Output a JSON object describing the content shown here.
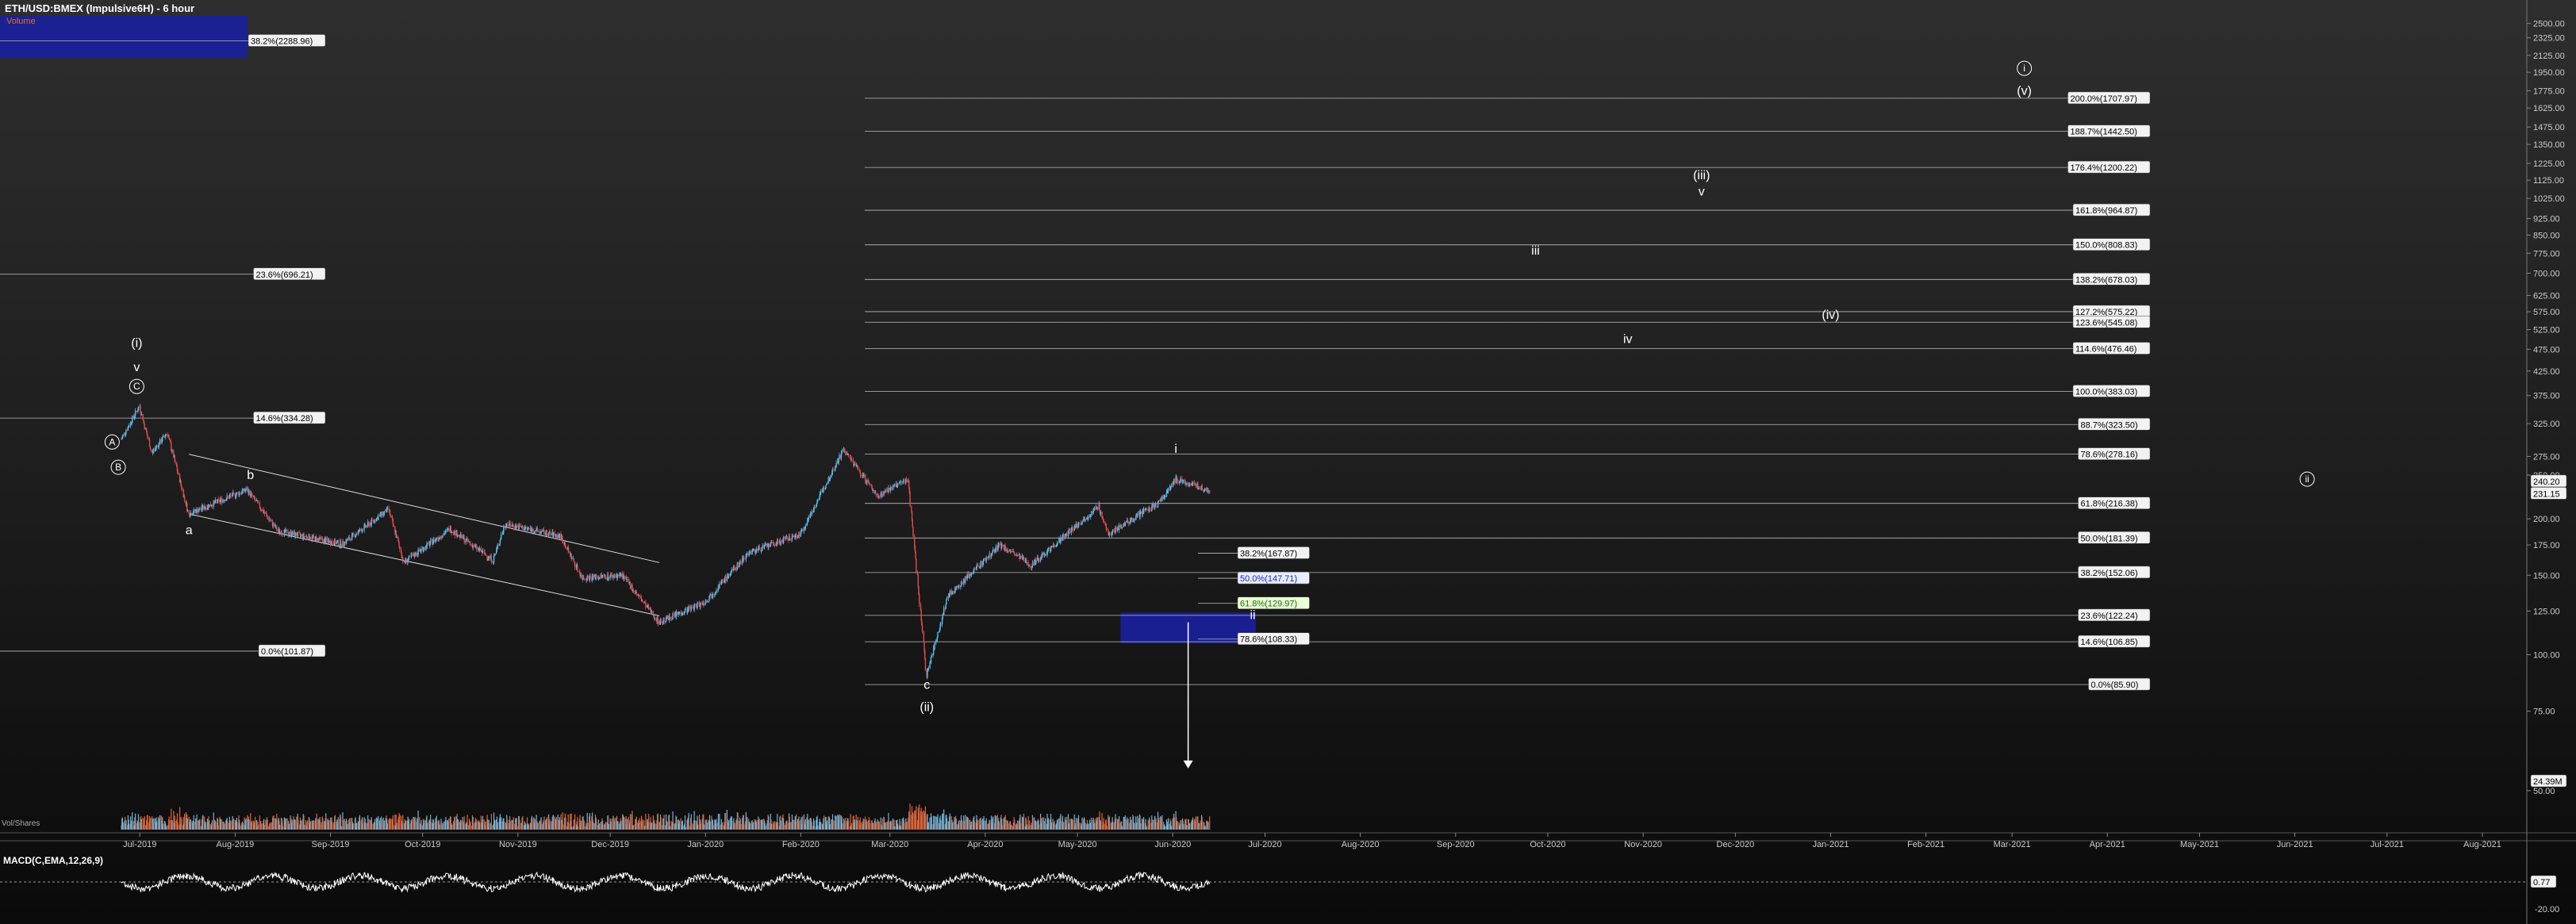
{
  "header": {
    "title": "ETH/USD:BMEX (Impulsive6H) - 6 hour",
    "volume_label": "Volume"
  },
  "macd_panel": {
    "label": "MACD(C,EMA,12,26,9)",
    "value_label": "0.77",
    "lower_label": "-20.00"
  },
  "volume_panel": {
    "label": "Vol/Shares",
    "value_label": "24.39M"
  },
  "colors": {
    "background_top": "#2e2e2e",
    "background_bottom": "#0a0a0a",
    "up_candle": "#4fc3f7",
    "down_candle": "#e34b4b",
    "fib_line": "#bbbbbb",
    "target_box": "#1a1f9e",
    "volume_up": "#6fb3d8",
    "volume_down": "#d9653b"
  },
  "chart_data": {
    "type": "candlestick",
    "title": "ETH/USD:BMEX (Impulsive6H) - 6 hour",
    "y_scale": "log",
    "y_ticks": [
      "2500.00",
      "2325.00",
      "2125.00",
      "1950.00",
      "1775.00",
      "1625.00",
      "1475.00",
      "1350.00",
      "1225.00",
      "1125.00",
      "1025.00",
      "925.00",
      "850.00",
      "775.00",
      "700.00",
      "625.00",
      "575.00",
      "525.00",
      "475.00",
      "425.00",
      "375.00",
      "325.00",
      "275.00",
      "250.00",
      "200.00",
      "175.00",
      "150.00",
      "125.00",
      "100.00",
      "75.00",
      "50.00"
    ],
    "ylim": [
      42,
      2600
    ],
    "current_price_labels": [
      "240.20",
      "231.15"
    ],
    "x_ticks": [
      "Jul-2019",
      "Aug-2019",
      "Sep-2019",
      "Oct-2019",
      "Nov-2019",
      "Dec-2019",
      "Jan-2020",
      "Feb-2020",
      "Mar-2020",
      "Apr-2020",
      "May-2020",
      "Jun-2020",
      "Jul-2020",
      "Aug-2020",
      "Sep-2020",
      "Oct-2020",
      "Nov-2020",
      "Dec-2020",
      "Jan-2021",
      "Feb-2021",
      "Mar-2021",
      "Apr-2021",
      "May-2021",
      "Jun-2021",
      "Jul-2021",
      "Aug-2021"
    ],
    "price_path": [
      {
        "date": "2019-06-25",
        "price": 300
      },
      {
        "date": "2019-07-01",
        "price": 355
      },
      {
        "date": "2019-07-05",
        "price": 280
      },
      {
        "date": "2019-07-10",
        "price": 310
      },
      {
        "date": "2019-07-17",
        "price": 205
      },
      {
        "date": "2019-07-31",
        "price": 225
      },
      {
        "date": "2019-08-05",
        "price": 232
      },
      {
        "date": "2019-08-15",
        "price": 188
      },
      {
        "date": "2019-09-05",
        "price": 176
      },
      {
        "date": "2019-09-20",
        "price": 210
      },
      {
        "date": "2019-09-25",
        "price": 160
      },
      {
        "date": "2019-10-10",
        "price": 190
      },
      {
        "date": "2019-10-24",
        "price": 162
      },
      {
        "date": "2019-10-28",
        "price": 195
      },
      {
        "date": "2019-11-15",
        "price": 183
      },
      {
        "date": "2019-11-22",
        "price": 148
      },
      {
        "date": "2019-12-05",
        "price": 150
      },
      {
        "date": "2019-12-17",
        "price": 118
      },
      {
        "date": "2020-01-01",
        "price": 131
      },
      {
        "date": "2020-01-15",
        "price": 168
      },
      {
        "date": "2020-02-01",
        "price": 185
      },
      {
        "date": "2020-02-15",
        "price": 285
      },
      {
        "date": "2020-02-26",
        "price": 225
      },
      {
        "date": "2020-03-07",
        "price": 245
      },
      {
        "date": "2020-03-13",
        "price": 90
      },
      {
        "date": "2020-03-20",
        "price": 135
      },
      {
        "date": "2020-04-06",
        "price": 175
      },
      {
        "date": "2020-04-16",
        "price": 158
      },
      {
        "date": "2020-05-08",
        "price": 213
      },
      {
        "date": "2020-05-11",
        "price": 185
      },
      {
        "date": "2020-05-28",
        "price": 218
      },
      {
        "date": "2020-06-02",
        "price": 245
      },
      {
        "date": "2020-06-13",
        "price": 231
      }
    ],
    "fib_levels_left": [
      {
        "label": "38.2%(2288.96)",
        "price": 2288.96
      },
      {
        "label": "23.6%(696.21)",
        "price": 696.21
      },
      {
        "label": "14.6%(334.28)",
        "price": 334.28
      },
      {
        "label": "0.0%(101.87)",
        "price": 101.87
      }
    ],
    "fib_levels_right": [
      {
        "label": "200.0%(1707.97)",
        "price": 1707.97
      },
      {
        "label": "188.7%(1442.50)",
        "price": 1442.5
      },
      {
        "label": "176.4%(1200.22)",
        "price": 1200.22
      },
      {
        "label": "161.8%(964.87)",
        "price": 964.87
      },
      {
        "label": "150.0%(808.83)",
        "price": 808.83
      },
      {
        "label": "138.2%(678.03)",
        "price": 678.03
      },
      {
        "label": "127.2%(575.22)",
        "price": 575.22
      },
      {
        "label": "123.6%(545.08)",
        "price": 545.08
      },
      {
        "label": "114.6%(476.46)",
        "price": 476.46
      },
      {
        "label": "100.0%(383.03)",
        "price": 383.03
      },
      {
        "label": "88.7%(323.50)",
        "price": 323.5
      },
      {
        "label": "78.6%(278.16)",
        "price": 278.16
      },
      {
        "label": "61.8%(216.38)",
        "price": 216.38
      },
      {
        "label": "50.0%(181.39)",
        "price": 181.39
      },
      {
        "label": "38.2%(152.06)",
        "price": 152.06
      },
      {
        "label": "23.6%(122.24)",
        "price": 122.24
      },
      {
        "label": "14.6%(106.85)",
        "price": 106.85
      },
      {
        "label": "0.0%(85.90)",
        "price": 85.9
      }
    ],
    "fib_levels_retrace": [
      {
        "label": "38.2%(167.87)",
        "price": 167.87,
        "style": "plain"
      },
      {
        "label": "50.0%(147.71)",
        "price": 147.71,
        "style": "highlight-blue"
      },
      {
        "label": "61.8%(129.97)",
        "price": 129.97,
        "style": "highlight-green"
      },
      {
        "label": "78.6%(108.33)",
        "price": 108.33,
        "style": "plain"
      }
    ],
    "wave_labels": [
      {
        "text": "(i)",
        "date": "2019-06-30",
        "price": 480
      },
      {
        "text": "v",
        "date": "2019-06-30",
        "price": 425
      },
      {
        "text": "C",
        "date": "2019-06-30",
        "price": 385,
        "circled": true
      },
      {
        "text": "A",
        "date": "2019-06-22",
        "price": 290,
        "circled": true
      },
      {
        "text": "B",
        "date": "2019-06-24",
        "price": 255,
        "circled": true
      },
      {
        "text": "a",
        "date": "2019-07-17",
        "price": 185
      },
      {
        "text": "b",
        "date": "2019-08-06",
        "price": 245
      },
      {
        "text": "(ii)",
        "date": "2020-03-13",
        "price": 75
      },
      {
        "text": "c",
        "date": "2020-03-13",
        "price": 84
      },
      {
        "text": "i",
        "date": "2020-06-02",
        "price": 280
      },
      {
        "text": "ii",
        "date": "2020-06-27",
        "price": 120
      },
      {
        "text": "iii",
        "date": "2020-09-27",
        "price": 770
      },
      {
        "text": "(iii)",
        "date": "2020-11-20",
        "price": 1130
      },
      {
        "text": "v",
        "date": "2020-11-20",
        "price": 1040
      },
      {
        "text": "iv",
        "date": "2020-10-27",
        "price": 490
      },
      {
        "text": "(iv)",
        "date": "2021-01-01",
        "price": 555
      },
      {
        "text": "i",
        "date": "2021-03-05",
        "price": 1950,
        "circled": true
      },
      {
        "text": "(v)",
        "date": "2021-03-05",
        "price": 1740
      },
      {
        "text": "ii",
        "date": "2021-06-05",
        "price": 240,
        "circled": true
      }
    ],
    "target_boxes": [
      {
        "from": "2020-05-15",
        "to": "2020-06-28",
        "top": 124,
        "bottom": 106
      },
      {
        "from": "2019-04-25",
        "to": "2019-08-05",
        "top": 2600,
        "bottom": 2100
      }
    ],
    "projection_arrow": {
      "date": "2020-06-06",
      "from": 118,
      "to": 56
    },
    "channel": {
      "upper": [
        {
          "date": "2019-07-17",
          "price": 278
        },
        {
          "date": "2019-12-17",
          "price": 160
        }
      ],
      "lower": [
        {
          "date": "2019-07-17",
          "price": 205
        },
        {
          "date": "2019-12-17",
          "price": 122
        }
      ]
    }
  }
}
